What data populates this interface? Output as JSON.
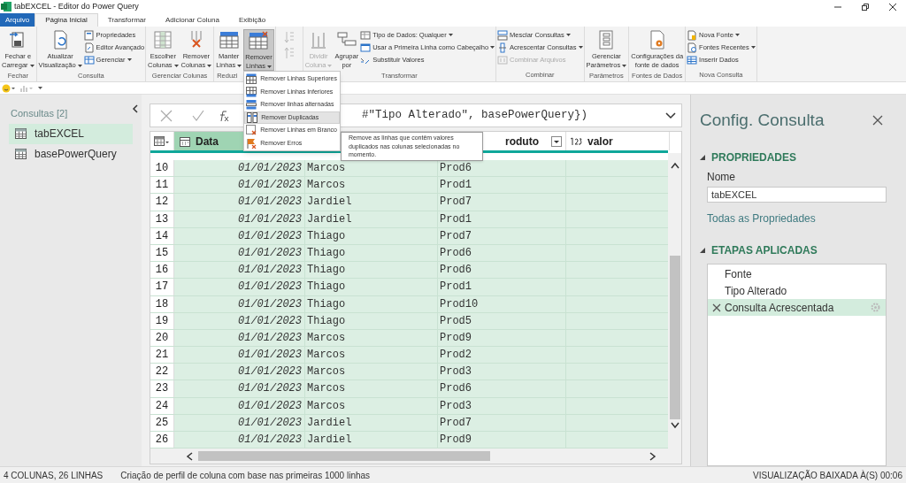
{
  "window": {
    "title": "tabEXCEL - Editor do Power Query"
  },
  "tabs": [
    {
      "label": "Arquivo",
      "kind": "file",
      "selected": false
    },
    {
      "label": "Página Inicial",
      "kind": "tab",
      "selected": true
    },
    {
      "label": "Transformar",
      "kind": "tab",
      "selected": false
    },
    {
      "label": "Adicionar Coluna",
      "kind": "tab",
      "selected": false
    },
    {
      "label": "Exibição",
      "kind": "tab",
      "selected": false
    }
  ],
  "ribbon": {
    "groups": [
      {
        "label": "Fechar",
        "buttons": [
          {
            "kind": "large",
            "lines": [
              "Fechar e",
              "Carregar"
            ],
            "dropdown": true,
            "disabled": false,
            "pressed": false
          }
        ]
      },
      {
        "label": "Consulta",
        "buttons": [
          {
            "kind": "large",
            "lines": [
              "Atualizar",
              "Visualização"
            ],
            "dropdown": true,
            "disabled": false,
            "pressed": false
          },
          {
            "kind": "small",
            "lines": [
              "Propriedades"
            ],
            "dropdown": false,
            "disabled": false
          },
          {
            "kind": "small",
            "lines": [
              "Editor Avançado"
            ],
            "dropdown": false,
            "disabled": false
          },
          {
            "kind": "small",
            "lines": [
              "Gerenciar"
            ],
            "dropdown": true,
            "disabled": false
          }
        ]
      },
      {
        "label": "Gerenciar Colunas",
        "buttons": [
          {
            "kind": "large",
            "lines": [
              "Escolher",
              "Colunas"
            ],
            "dropdown": true,
            "disabled": false,
            "pressed": false
          },
          {
            "kind": "large",
            "lines": [
              "Remover",
              "Colunas"
            ],
            "dropdown": true,
            "disabled": false,
            "pressed": false
          }
        ]
      },
      {
        "label": "Reduzi",
        "buttons": [
          {
            "kind": "large",
            "lines": [
              "Manter",
              "Linhas"
            ],
            "dropdown": true,
            "disabled": false,
            "pressed": false
          },
          {
            "kind": "large",
            "lines": [
              "Remover",
              "Linhas"
            ],
            "dropdown": true,
            "disabled": false,
            "pressed": true
          }
        ]
      },
      {
        "buttons": [
          {
            "kind": "sort",
            "disabled": true
          }
        ]
      },
      {
        "label": "Transformar",
        "buttons": [
          {
            "kind": "large",
            "lines": [
              "Dividir",
              "Coluna"
            ],
            "dropdown": true,
            "disabled": true,
            "pressed": false
          },
          {
            "kind": "large",
            "lines": [
              "Agrupar",
              "por"
            ],
            "dropdown": false,
            "disabled": false,
            "pressed": false
          },
          {
            "kind": "small",
            "lines": [
              "Tipo de Dados: Qualquer"
            ],
            "dropdown": true,
            "disabled": false
          },
          {
            "kind": "small",
            "lines": [
              "Usar a Primeira Linha como Cabeçalho"
            ],
            "dropdown": true,
            "disabled": false
          },
          {
            "kind": "small",
            "lines": [
              "Substituir Valores"
            ],
            "dropdown": false,
            "disabled": false
          }
        ]
      },
      {
        "label": "Combinar",
        "buttons": [
          {
            "kind": "small",
            "lines": [
              "Mesclar Consultas"
            ],
            "dropdown": true,
            "disabled": false
          },
          {
            "kind": "small",
            "lines": [
              "Acrescentar Consultas"
            ],
            "dropdown": true,
            "disabled": false
          },
          {
            "kind": "small",
            "lines": [
              "Combinar Arquivos"
            ],
            "dropdown": false,
            "disabled": true
          }
        ]
      },
      {
        "label": "Parâmetros",
        "buttons": [
          {
            "kind": "large",
            "lines": [
              "Gerenciar",
              "Parâmetros"
            ],
            "dropdown": true,
            "disabled": false,
            "pressed": false
          }
        ]
      },
      {
        "label": "Fontes de Dados",
        "buttons": [
          {
            "kind": "large",
            "lines": [
              "Configurações da",
              "fonte de dados"
            ],
            "dropdown": false,
            "disabled": false,
            "pressed": false
          }
        ]
      },
      {
        "label": "Nova Consulta",
        "buttons": [
          {
            "kind": "small",
            "lines": [
              "Nova Fonte"
            ],
            "dropdown": true,
            "disabled": false
          },
          {
            "kind": "small",
            "lines": [
              "Fontes Recentes"
            ],
            "dropdown": true,
            "disabled": false
          },
          {
            "kind": "small",
            "lines": [
              "Inserir Dados"
            ],
            "dropdown": false,
            "disabled": false
          }
        ]
      }
    ]
  },
  "menu": {
    "items": [
      {
        "label": "Remover Linhas Superiores",
        "selected": false
      },
      {
        "label": "Remover Linhas Inferiores",
        "selected": false
      },
      {
        "label": "Remover linhas alternadas",
        "selected": false
      },
      {
        "label": "Remover Duplicadas",
        "selected": true
      },
      {
        "label": "Remover Linhas em Branco",
        "selected": false
      },
      {
        "label": "Remover Erros",
        "selected": false
      }
    ],
    "tooltip": "Remove as linhas que contêm valores duplicados nas colunas selecionadas no momento."
  },
  "queries": {
    "title": "Consultas [2]",
    "items": [
      {
        "label": "tabEXCEL",
        "selected": true
      },
      {
        "label": "basePowerQuery",
        "selected": false
      }
    ]
  },
  "formula_bar": {
    "formula": "#\"Tipo Alterado\", basePowerQuery})"
  },
  "table": {
    "columns": [
      {
        "label": "Data"
      },
      {},
      {
        "label": "roduto"
      },
      {
        "label": "valor"
      }
    ],
    "rows": [
      {
        "n": "10",
        "date": "01/01/2023",
        "name": "Marcos",
        "product": "Prod6"
      },
      {
        "n": "11",
        "date": "01/01/2023",
        "name": "Marcos",
        "product": "Prod1"
      },
      {
        "n": "12",
        "date": "01/01/2023",
        "name": "Jardiel",
        "product": "Prod7"
      },
      {
        "n": "13",
        "date": "01/01/2023",
        "name": "Jardiel",
        "product": "Prod1"
      },
      {
        "n": "14",
        "date": "01/01/2023",
        "name": "Thiago",
        "product": "Prod7"
      },
      {
        "n": "15",
        "date": "01/01/2023",
        "name": "Thiago",
        "product": "Prod6"
      },
      {
        "n": "16",
        "date": "01/01/2023",
        "name": "Thiago",
        "product": "Prod6"
      },
      {
        "n": "17",
        "date": "01/01/2023",
        "name": "Thiago",
        "product": "Prod1"
      },
      {
        "n": "18",
        "date": "01/01/2023",
        "name": "Thiago",
        "product": "Prod10"
      },
      {
        "n": "19",
        "date": "01/01/2023",
        "name": "Thiago",
        "product": "Prod5"
      },
      {
        "n": "20",
        "date": "01/01/2023",
        "name": "Marcos",
        "product": "Prod9"
      },
      {
        "n": "21",
        "date": "01/01/2023",
        "name": "Marcos",
        "product": "Prod2"
      },
      {
        "n": "22",
        "date": "01/01/2023",
        "name": "Marcos",
        "product": "Prod3"
      },
      {
        "n": "23",
        "date": "01/01/2023",
        "name": "Marcos",
        "product": "Prod6"
      },
      {
        "n": "24",
        "date": "01/01/2023",
        "name": "Marcos",
        "product": "Prod3"
      },
      {
        "n": "25",
        "date": "01/01/2023",
        "name": "Jardiel",
        "product": "Prod7"
      },
      {
        "n": "26",
        "date": "01/01/2023",
        "name": "Jardiel",
        "product": "Prod9"
      }
    ]
  },
  "settings": {
    "title": "Config. Consulta",
    "properties": {
      "heading": "PROPRIEDADES",
      "expanded": true,
      "name_label": "Nome",
      "name_value": "tabEXCEL",
      "link": "Todas as Propriedades"
    },
    "steps": {
      "heading": "ETAPAS APLICADAS",
      "expanded": true,
      "items": [
        {
          "label": "Fonte",
          "selected": false
        },
        {
          "label": "Tipo Alterado",
          "selected": false
        },
        {
          "label": "Consulta Acrescentada",
          "selected": true
        }
      ]
    }
  },
  "status_bar": {
    "counts": "4 COLUNAS, 26 LINHAS",
    "profiling": "Criação de perfil de coluna com base nas primeiras 1000 linhas",
    "download": "VISUALIZAÇÃO BAIXADA À(S) 00:06"
  }
}
